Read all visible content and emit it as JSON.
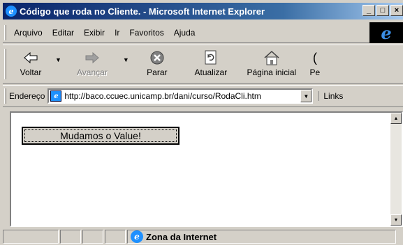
{
  "window": {
    "title": "Código que roda no Cliente. - Microsoft Internet Explorer",
    "min_label": "_",
    "max_label": "□",
    "close_label": "×"
  },
  "menu": {
    "items": [
      {
        "label": "Arquivo"
      },
      {
        "label": "Editar"
      },
      {
        "label": "Exibir"
      },
      {
        "label": "Ir"
      },
      {
        "label": "Favoritos"
      },
      {
        "label": "Ajuda"
      }
    ]
  },
  "toolbar": {
    "back_label": "Voltar",
    "forward_label": "Avançar",
    "stop_label": "Parar",
    "refresh_label": "Atualizar",
    "home_label": "Página inicial",
    "search_label": "Pe"
  },
  "address": {
    "label": "Endereço",
    "url": "http://baco.ccuec.unicamp.br/dani/curso/RodaCli.htm",
    "links_label": "Links"
  },
  "page": {
    "button_label": "Mudamos o Value!"
  },
  "status": {
    "zone_label": "Zona da Internet"
  },
  "colors": {
    "title_gradient_start": "#0a246a",
    "title_gradient_end": "#a6caf0",
    "chrome": "#d4d0c8"
  }
}
